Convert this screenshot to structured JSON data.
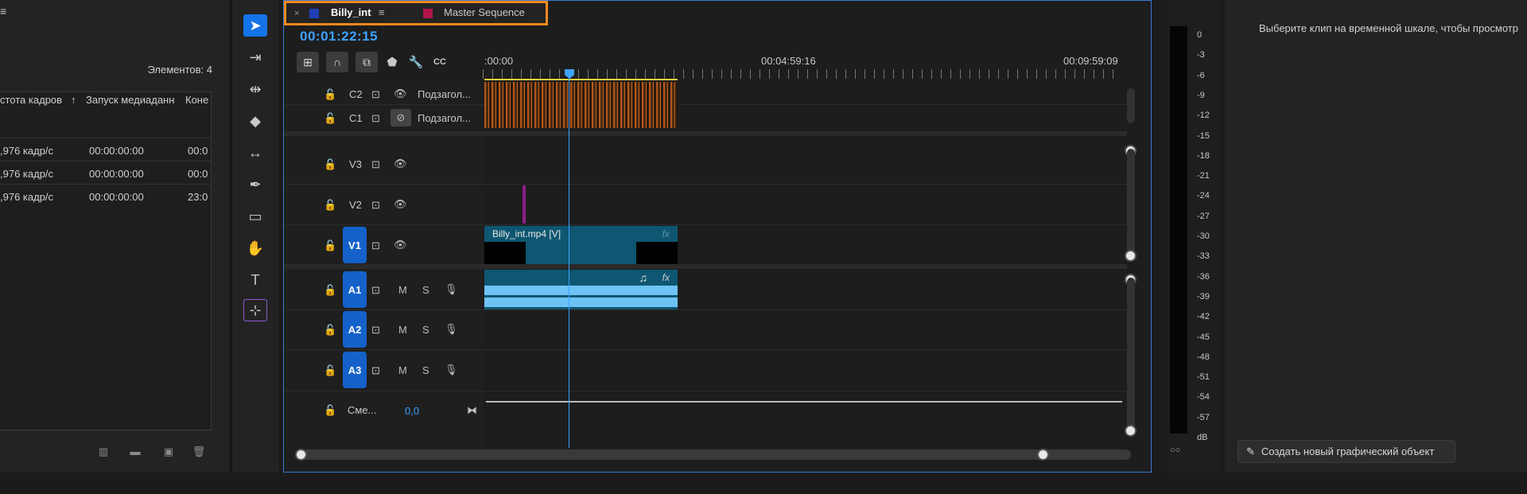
{
  "project": {
    "items_count": "Элементов: 4",
    "headers": [
      "стота кадров",
      "↑",
      "Запуск медиаданн",
      "Коне"
    ],
    "rows": [
      {
        "rate": ",976 кадр/с",
        "start": "00:00:00:00",
        "end": "00:0"
      },
      {
        "rate": ",976 кадр/с",
        "start": "00:00:00:00",
        "end": "00:0"
      },
      {
        "rate": ",976 кадр/с",
        "start": "00:00:00:00",
        "end": "23:0"
      }
    ]
  },
  "timeline": {
    "tabs": [
      {
        "label": "Billy_int",
        "color": "#1f3fb4",
        "close": "×",
        "menu": "≡"
      },
      {
        "label": "Master Sequence",
        "color": "#b0154a"
      }
    ],
    "timecode": "00:01:22:15",
    "ruler": [
      ":00:00",
      "00:04:59:16",
      "00:09:59:09"
    ],
    "caption_tracks": [
      {
        "name": "C2",
        "label": "Подзагол..."
      },
      {
        "name": "C1",
        "label": "Подзагол..."
      }
    ],
    "video_tracks": [
      "V3",
      "V2",
      "V1"
    ],
    "audio_tracks": [
      "A1",
      "A2",
      "A3"
    ],
    "audio_buttons": {
      "mute": "M",
      "solo": "S"
    },
    "mix": {
      "label": "Сме...",
      "value": "0,0"
    },
    "video_clip": {
      "name": "Billy_int.mp4 [V]",
      "fx": "fx"
    },
    "audio_clip": {
      "fx": "fx",
      "note": "♫"
    }
  },
  "meter": {
    "ticks": [
      "0",
      "-3",
      "-6",
      "-9",
      "-12",
      "-15",
      "-18",
      "-21",
      "-24",
      "-27",
      "-30",
      "-33",
      "-36",
      "-39",
      "-42",
      "-45",
      "-48",
      "-51",
      "-54",
      "-57",
      "dB"
    ],
    "solo": "○○"
  },
  "graphics": {
    "hint": "Выберите клип на временной шкале, чтобы просмотр",
    "create_button": "Создать новый графический объект"
  }
}
